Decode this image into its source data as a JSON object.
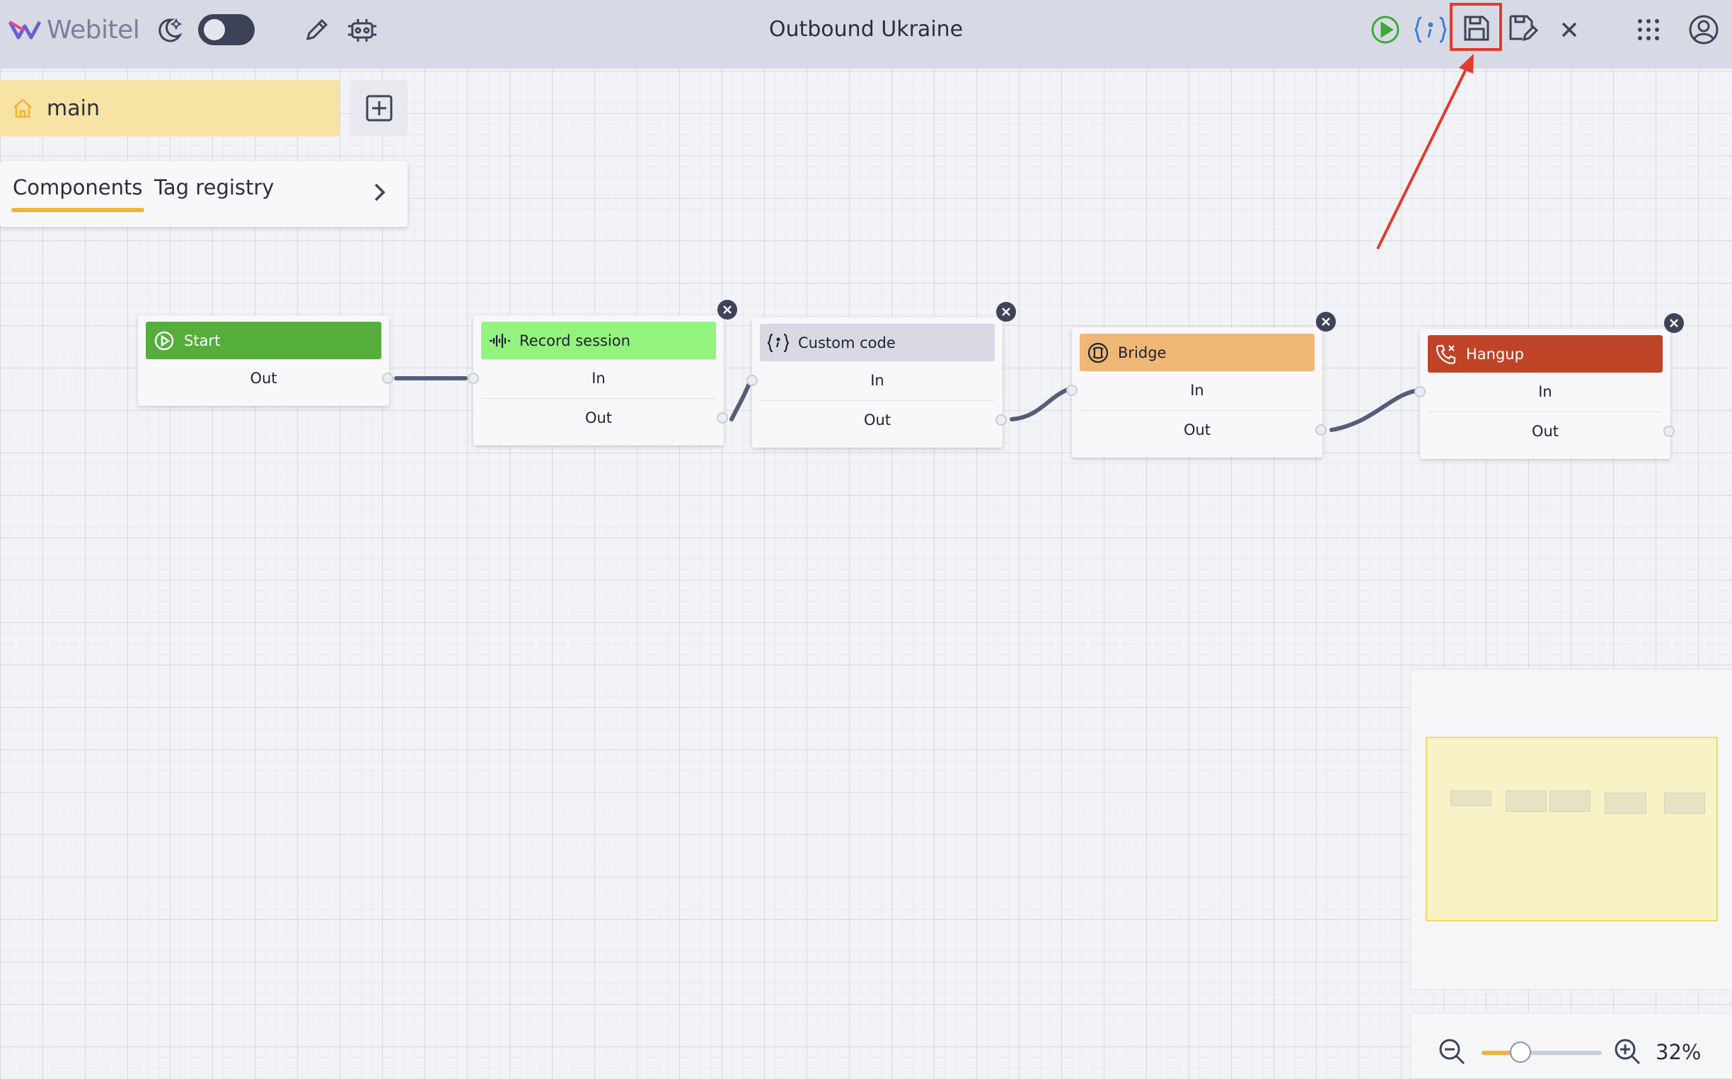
{
  "app": {
    "logo_text": "Webitel",
    "title": "Outbound Ukraine"
  },
  "toolbar": {
    "icons": [
      "dark-mode-icon",
      "pencil-icon",
      "debug-icon",
      "play-icon",
      "code-braces-icon",
      "save-icon",
      "save-as-icon",
      "close-icon",
      "apps-grid-icon",
      "account-icon"
    ],
    "highlighted": "save-icon"
  },
  "tabs": {
    "main_label": "main"
  },
  "panel": {
    "tabs": [
      "Components",
      "Tag registry"
    ],
    "active": "Components"
  },
  "nodes": [
    {
      "title": "Start",
      "color": "#55ad3b",
      "text_color": "#ffffff",
      "ports": [
        "Out"
      ]
    },
    {
      "title": "Record session",
      "color": "#94f27e",
      "text_color": "#1e2130",
      "ports": [
        "In",
        "Out"
      ]
    },
    {
      "title": "Custom code",
      "color": "#d8d9e3",
      "text_color": "#1e2130",
      "ports": [
        "In",
        "Out"
      ]
    },
    {
      "title": "Bridge",
      "color": "#efb776",
      "text_color": "#1e2130",
      "ports": [
        "In",
        "Out"
      ]
    },
    {
      "title": "Hangup",
      "color": "#bf4427",
      "text_color": "#ffffff",
      "ports": [
        "In",
        "Out"
      ]
    }
  ],
  "zoom": {
    "percent_label": "32%",
    "value": 0.32
  },
  "colors": {
    "accent": "#f0b43c",
    "highlight": "#e03b2f",
    "topbar": "#d7dae4"
  }
}
